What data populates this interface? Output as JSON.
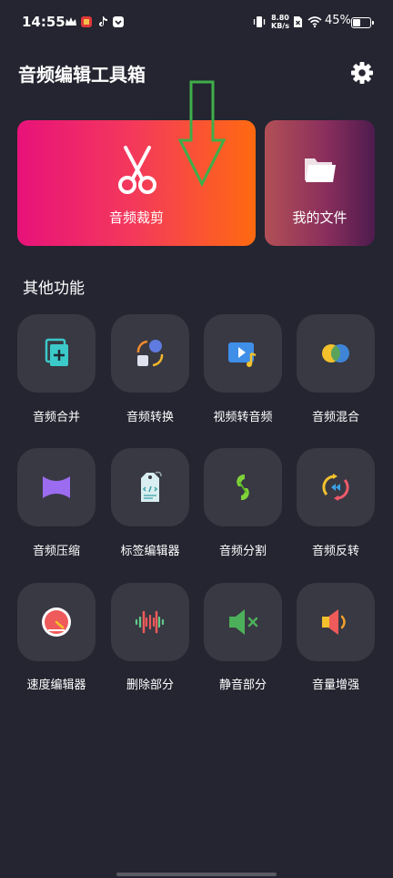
{
  "status_bar": {
    "time": "14:55",
    "net_speed_value": "8.80",
    "net_speed_unit": "KB/s",
    "battery": "45%"
  },
  "header": {
    "title": "音频编辑工具箱"
  },
  "hero": {
    "cut_label": "音频裁剪",
    "files_label": "我的文件"
  },
  "section_title": "其他功能",
  "tools": [
    {
      "label": "音频合并"
    },
    {
      "label": "音频转换"
    },
    {
      "label": "视频转音频"
    },
    {
      "label": "音频混合"
    },
    {
      "label": "音频压缩"
    },
    {
      "label": "标签编辑器"
    },
    {
      "label": "音频分割"
    },
    {
      "label": "音频反转"
    },
    {
      "label": "速度编辑器"
    },
    {
      "label": "删除部分"
    },
    {
      "label": "静音部分"
    },
    {
      "label": "音量增强"
    }
  ],
  "colors": {
    "background": "#242530",
    "tile": "#383943",
    "accent_green_arrow": "#3fae4a"
  }
}
